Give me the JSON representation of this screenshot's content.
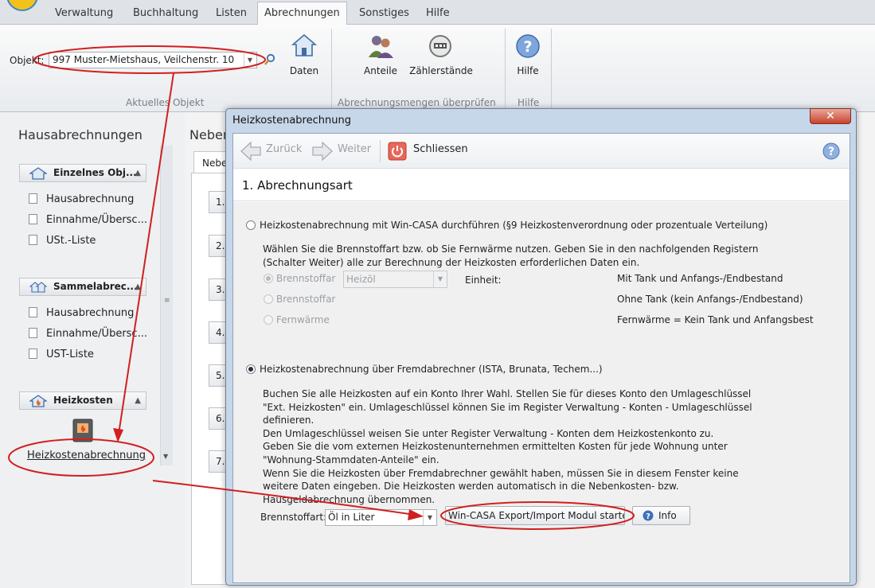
{
  "ribbon": {
    "tabs": [
      "Verwaltung",
      "Buchhaltung",
      "Listen",
      "Abrechnungen",
      "Sonstiges",
      "Hilfe"
    ],
    "object_label": "Objekt:",
    "object_value": "997 Muster-Mietshaus, Veilchenstr. 10",
    "btn_daten": "Daten",
    "btn_anteile": "Anteile",
    "btn_zaehler": "Zählerstände",
    "btn_hilfe": "Hilfe",
    "group_aktuelles": "Aktuelles Objekt",
    "group_mengen": "Abrechnungsmengen überprüfen",
    "group_hilfe": "Hilfe"
  },
  "left": {
    "title": "Hausabrechnungen",
    "sections": [
      {
        "header": "Einzelnes Obj...",
        "items": [
          "Hausabrechnung",
          "Einnahme/Übersc...",
          "USt.-Liste"
        ]
      },
      {
        "header": "Sammelabrec...",
        "items": [
          "Hausabrechnung",
          "Einnahme/Übersc...",
          "UST-Liste"
        ]
      },
      {
        "header": "Heizkosten",
        "items": [
          "Heizkostenabrechnung"
        ]
      }
    ]
  },
  "background": {
    "title": "Neben",
    "tab": "Nebe",
    "buttons": [
      "1.",
      "2.",
      "3.",
      "4.",
      "5.",
      "6.",
      "7."
    ]
  },
  "dialog": {
    "title": "Heizkostenabrechnung",
    "close_glyph": "✕",
    "toolbar": {
      "back": "Zurück",
      "next": "Weiter",
      "close": "Schliessen"
    },
    "step_title": "1. Abrechnungsart",
    "opt1": {
      "label": "Heizkostenabrechnung mit Win-CASA durchführen (§9 Heizkostenverordnung oder prozentuale Verteilung)",
      "desc": "Wählen Sie die Brennstoffart bzw. ob Sie Fernwärme nutzen. Geben Sie in den nachfolgenden Registern\n(Schalter Weiter) alle zur Berechnung der Heizkosten erforderlichen Daten ein.",
      "sub_options": [
        "Brennstoffar",
        "Brennstoffar",
        "Fernwärme"
      ],
      "fuel_value": "Heizöl",
      "unit_label": "Einheit:",
      "notes": [
        "Mit Tank und Anfangs-/Endbestand",
        "Ohne Tank (kein Anfangs-/Endbestand)",
        "Fernwärme = Kein Tank und Anfangsbest"
      ]
    },
    "opt2": {
      "label": "Heizkostenabrechnung über Fremdabrechner (ISTA, Brunata, Techem...)",
      "desc": "Buchen Sie alle Heizkosten auf ein Konto Ihrer Wahl. Stellen Sie für dieses Konto den Umlageschlüssel\n\"Ext. Heizkosten\" ein. Umlageschlüssel können Sie im Register Verwaltung - Konten - Umlageschlüssel\ndefinieren.\nDen Umlageschlüssel weisen Sie unter Register Verwaltung - Konten dem Heizkostenkonto zu.\nGeben Sie die vom externen Heizkostenunternehmen ermittelten Kosten für jede Wohnung unter\n\"Wohnung-Stammdaten-Anteile\" ein.\nWenn Sie die Heizkosten über Fremdabrechner gewählt haben, müssen Sie in diesem Fenster keine\nweitere Daten eingeben. Die Heizkosten werden automatisch in die Nebenkosten- bzw.\nHausgeldabrechnung übernommen.",
      "fuel_label": "Brennstoffart:",
      "fuel_value": "Öl in Liter",
      "export_btn": "Win-CASA Export/Import Modul starten",
      "info_btn": "Info"
    }
  },
  "colors": {
    "annotation": "#d21f1f",
    "dialog_frame": "#c7d7ea",
    "accent": "#3a86c8"
  }
}
